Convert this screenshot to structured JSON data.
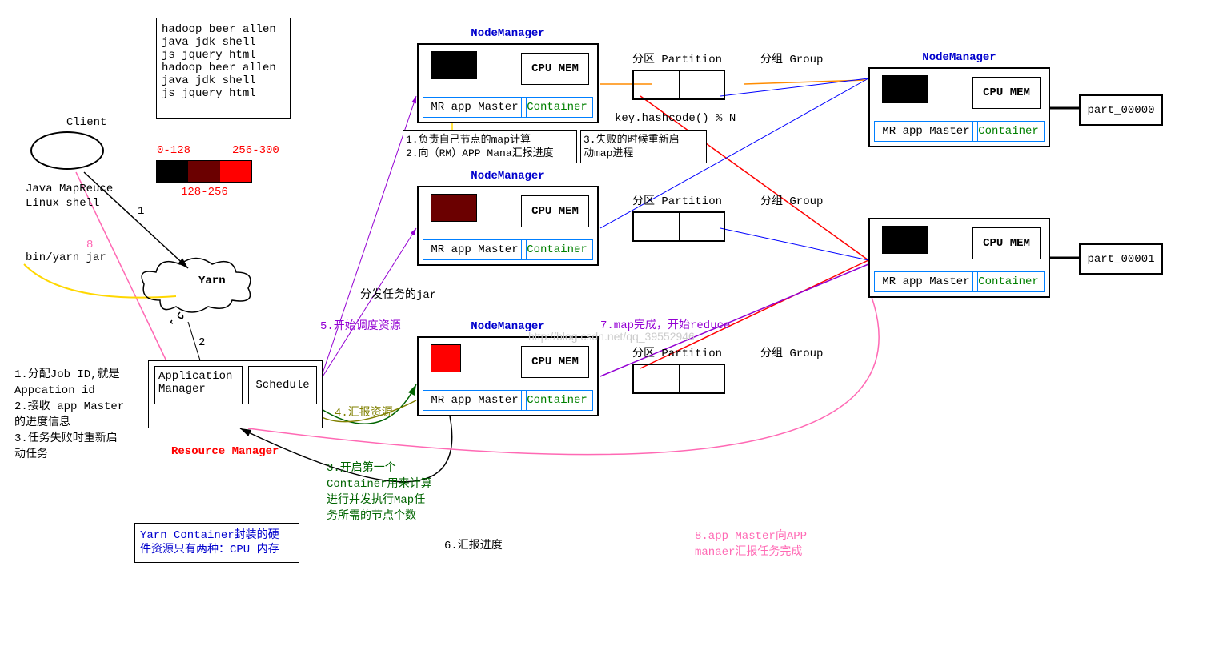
{
  "client": {
    "title": "Client",
    "tech1": "Java MapReuce",
    "tech2": "Linux shell",
    "cmd": "bin/yarn jar"
  },
  "textbox": {
    "l1": "hadoop beer allen",
    "l2": "java jdk shell",
    "l3": "js jquery html",
    "l4": "hadoop beer allen",
    "l5": "java jdk shell",
    "l6": "js jquery html"
  },
  "splits": {
    "s1": "0-128",
    "s2": "256-300",
    "s3": "128-256"
  },
  "yarn": {
    "label": "Yarn",
    "am_l1": "Application",
    "am_l2": "Manager",
    "sched": "Schedule",
    "rm": "Resource Manager"
  },
  "notes": {
    "left": "1.分配Job ID,就是\nAppcation id\n2.接收 app Master\n的进度信息\n3.任务失败时重新启\n动任务",
    "nm1": "1.负责自己节点的map计算\n2.向（RM）APP Mana汇报进度",
    "nm2": "3.失败的时候重新启\n动map进程"
  },
  "steps": {
    "s1": "1",
    "s2": "2",
    "s3": "3.开启第一个\nContainer用来计算\n进行并发执行Map任\n务所需的节点个数",
    "s4": "4.汇报资源",
    "s5": "5.开始调度资源",
    "s5b": "分发任务的jar",
    "s6": "6.汇报进度",
    "s7": "7.map完成，开始reduce",
    "s8": "8.app Master向APP\nmanaer汇报任务完成",
    "s8n": "8"
  },
  "nm": {
    "title": "NodeManager",
    "cpu": "CPU MEM",
    "master": "MR app Master",
    "container": "Container"
  },
  "pg": {
    "part": "分区 Partition",
    "group": "分组 Group",
    "hash": "key.hashcode() % N"
  },
  "out": {
    "p0": "part_00000",
    "p1": "part_00001"
  },
  "footer": {
    "text": "Yarn Container封装的硬\n件资源只有两种：CPU 内存"
  },
  "watermark": "http://blog.csdn.net/qq_39552946"
}
